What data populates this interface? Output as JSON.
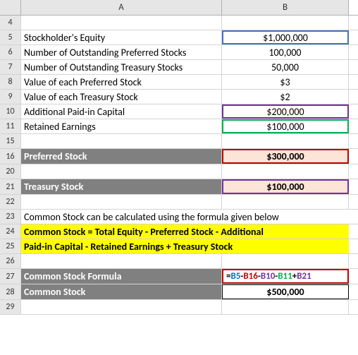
{
  "columns": {
    "a": "A",
    "b": "B"
  },
  "rows": {
    "r4": "4",
    "r5": "5",
    "r6": "6",
    "r7": "7",
    "r8": "8",
    "r9": "9",
    "r10": "10",
    "r11": "11",
    "r15": "15",
    "r16": "16",
    "r20": "20",
    "r21": "21",
    "r22": "22",
    "r23": "23",
    "r24": "24",
    "r25": "25",
    "r26": "26",
    "r27": "27",
    "r28": "28",
    "r29": "29"
  },
  "cells": {
    "a5": "Stockholder's Equity",
    "b5": "$1,000,000",
    "a6": "Number of Outstanding Preferred Stocks",
    "b6": "100,000",
    "a7": "Number of Outstanding Treasury Stocks",
    "b7": "50,000",
    "a8": "Value of each Preferred Stock",
    "b8": "$3",
    "a9": "Value of each Treasury Stock",
    "b9": "$2",
    "a10": "Additional Paid-in Capital",
    "b10": "$200,000",
    "a11": "Retained Earnings",
    "b11": "$100,000",
    "a16": "Preferred Stock",
    "b16": "$300,000",
    "a21": "Treasury Stock",
    "b21": "$100,000",
    "a23": "Common Stock can be calculated using the formula given below",
    "a24": "Common Stock = Total Equity - Preferred Stock - Additional",
    "a25": "Paid-in Capital - Retained Earnings + Treasury Stock",
    "a27": "Common Stock Formula",
    "a28": "Common Stock",
    "b28": "$500,000"
  },
  "formula": {
    "eq": "=",
    "p1": "B5",
    "m1": "-",
    "p2": "B16",
    "m2": "-",
    "p3": "B10",
    "m3": "-",
    "p4": "B11",
    "plus": "+",
    "p5": "B21"
  },
  "chart_data": {
    "type": "table",
    "title": "Common Stock Formula Spreadsheet",
    "rows": [
      {
        "label": "Stockholder's Equity",
        "value": 1000000
      },
      {
        "label": "Number of Outstanding Preferred Stocks",
        "value": 100000
      },
      {
        "label": "Number of Outstanding Treasury Stocks",
        "value": 50000
      },
      {
        "label": "Value of each Preferred Stock",
        "value": 3
      },
      {
        "label": "Value of each Treasury Stock",
        "value": 2
      },
      {
        "label": "Additional Paid-in Capital",
        "value": 200000
      },
      {
        "label": "Retained Earnings",
        "value": 100000
      },
      {
        "label": "Preferred Stock",
        "value": 300000
      },
      {
        "label": "Treasury Stock",
        "value": 100000
      },
      {
        "label": "Common Stock",
        "value": 500000
      }
    ],
    "formula": "Common Stock = Total Equity - Preferred Stock - Additional Paid-in Capital - Retained Earnings + Treasury Stock",
    "cell_formula": "=B5-B16-B10-B11+B21"
  }
}
